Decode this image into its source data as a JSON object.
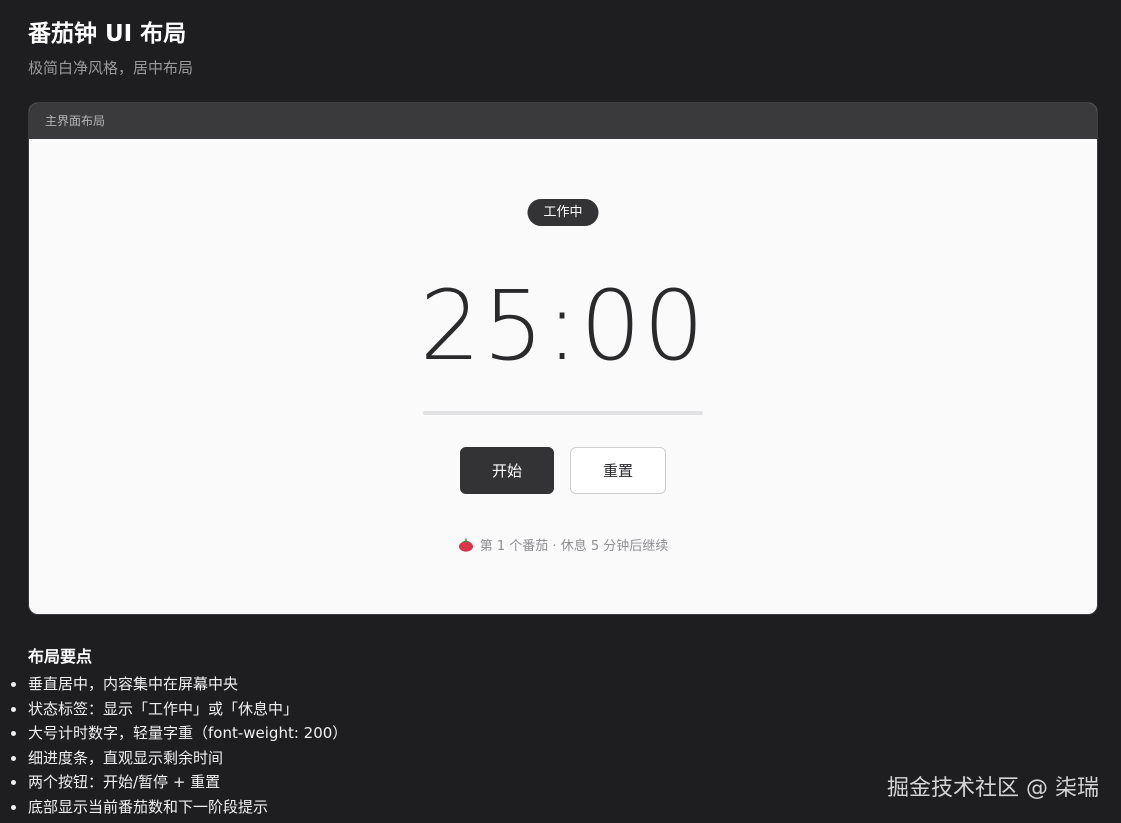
{
  "page": {
    "title": "番茄钟 UI 布局",
    "subtitle": "极简白净风格，居中布局"
  },
  "card": {
    "header_label": "主界面布局",
    "status_label": "工作中",
    "timer": "25:00",
    "progress": 0,
    "buttons": {
      "start_label": "开始",
      "reset_label": "重置"
    },
    "footer": {
      "icon": "tomato-icon",
      "text": "第 1 个番茄 · 休息 5 分钟后继续"
    }
  },
  "notes": {
    "title": "布局要点",
    "items": [
      "垂直居中，内容集中在屏幕中央",
      "状态标签：显示「工作中」或「休息中」",
      "大号计时数字，轻量字重（font-weight: 200）",
      "细进度条，直观显示剩余时间",
      "两个按钮：开始/暂停 + 重置",
      "底部显示当前番茄数和下一阶段提示"
    ]
  },
  "watermark": "掘金技术社区 @ 柒瑞",
  "colors": {
    "background": "#1e1e20",
    "card": "#fafafa",
    "dark_accent": "#333336",
    "tomato": "#d9344a"
  }
}
